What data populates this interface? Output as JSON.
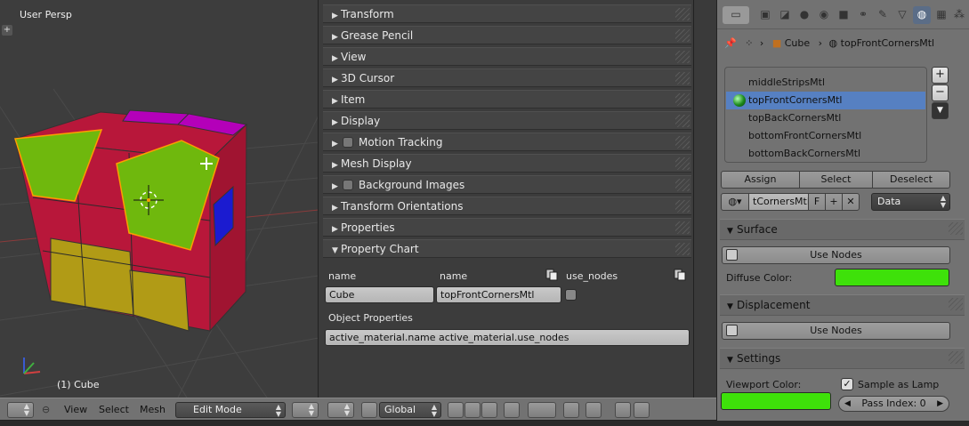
{
  "viewport": {
    "label": "User Persp",
    "object_label": "(1) Cube",
    "add_icon": "plus-icon"
  },
  "bottom_header": {
    "view": "View",
    "select": "Select",
    "mesh": "Mesh",
    "mode": "Edit Mode",
    "orientation": "Global"
  },
  "n_panel": {
    "panels": [
      {
        "label": "Transform",
        "expanded": false,
        "checkbox": false
      },
      {
        "label": "Grease Pencil",
        "expanded": false,
        "checkbox": false
      },
      {
        "label": "View",
        "expanded": false,
        "checkbox": false
      },
      {
        "label": "3D Cursor",
        "expanded": false,
        "checkbox": false
      },
      {
        "label": "Item",
        "expanded": false,
        "checkbox": false
      },
      {
        "label": "Display",
        "expanded": false,
        "checkbox": false
      },
      {
        "label": "Motion Tracking",
        "expanded": false,
        "checkbox": true
      },
      {
        "label": "Mesh Display",
        "expanded": false,
        "checkbox": false
      },
      {
        "label": "Background Images",
        "expanded": false,
        "checkbox": true
      },
      {
        "label": "Transform Orientations",
        "expanded": false,
        "checkbox": false
      },
      {
        "label": "Properties",
        "expanded": false,
        "checkbox": false
      },
      {
        "label": "Property Chart",
        "expanded": true,
        "checkbox": false
      }
    ],
    "chart": {
      "col1_header": "name",
      "col2_header": "name",
      "col3_header": "use_nodes",
      "row_name": "Cube",
      "row_material": "topFrontCornersMtl",
      "object_properties_label": "Object Properties",
      "object_properties_value": "active_material.name active_material.use_nodes"
    }
  },
  "properties": {
    "breadcrumb": {
      "object": "Cube",
      "material": "topFrontCornersMtl"
    },
    "materials": [
      {
        "name": "middleStripsMtl",
        "selected": false
      },
      {
        "name": "topFrontCornersMtl",
        "selected": true
      },
      {
        "name": "topBackCornersMtl",
        "selected": false
      },
      {
        "name": "bottomFrontCornersMtl",
        "selected": false
      },
      {
        "name": "bottomBackCornersMtl",
        "selected": false
      }
    ],
    "assign": "Assign",
    "select": "Select",
    "deselect": "Deselect",
    "mat_field": "tCornersMtl",
    "fake_user": "F",
    "link": "Data",
    "surface": {
      "title": "Surface",
      "use_nodes": "Use Nodes",
      "diffuse_label": "Diffuse Color:",
      "diffuse_color": "#3ee10a"
    },
    "displacement": {
      "title": "Displacement",
      "use_nodes": "Use Nodes"
    },
    "settings": {
      "title": "Settings",
      "viewport_color_label": "Viewport Color:",
      "viewport_color": "#3ee10a",
      "sample_as_lamp": "Sample as Lamp",
      "sample_as_lamp_checked": true,
      "pass_index": "Pass Index: 0"
    }
  },
  "colors": {
    "cube_red": "#b8173a",
    "cube_green": "#6fb80d",
    "cube_yellow": "#b19b16",
    "cube_magenta": "#b400b9",
    "cube_blue": "#1b1bd0",
    "selection": "#ff9c00"
  }
}
